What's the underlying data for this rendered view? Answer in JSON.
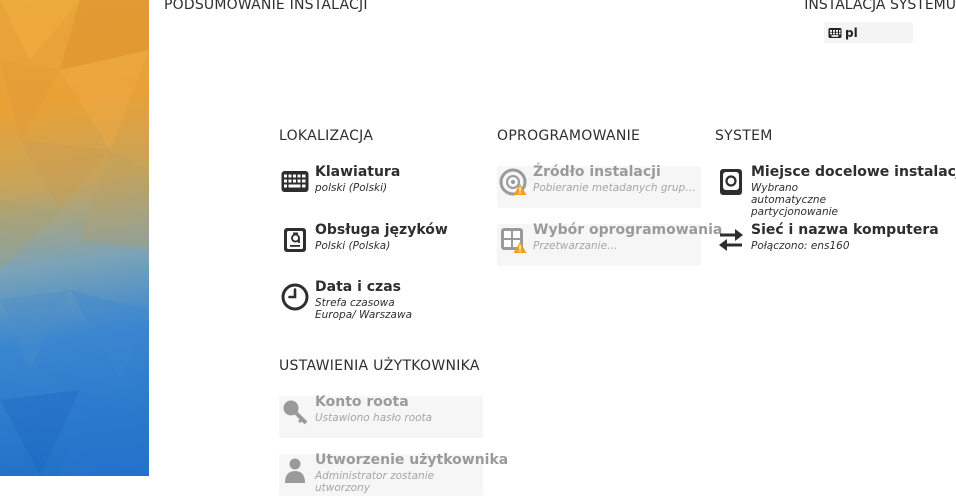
{
  "header": {
    "page_title": "PODSUMOWANIE INSTALACJI",
    "install_title": "INSTALACJA SYSTEMU",
    "keyboard_layout": "pl"
  },
  "sections": {
    "localization": {
      "title": "LOKALIZACJA",
      "keyboard": {
        "title": "Klawiatura",
        "status": "polski (Polski)"
      },
      "language": {
        "title": "Obsługa języków",
        "status": "Polski (Polska)"
      },
      "datetime": {
        "title": "Data i czas",
        "status": "Strefa czasowa Europa/ Warszawa"
      }
    },
    "software": {
      "title": "OPROGRAMOWANIE",
      "source": {
        "title": "Źródło instalacji",
        "status": "Pobieranie metadanych grup…"
      },
      "selection": {
        "title": "Wybór oprogramowania",
        "status": "Przetwarzanie…"
      }
    },
    "system": {
      "title": "SYSTEM",
      "destination": {
        "title": "Miejsce docelowe instalacji",
        "status": "Wybrano automatyczne partycjonowanie"
      },
      "network": {
        "title": "Sieć i nazwa komputera",
        "status": "Połączono: ens160"
      }
    },
    "user": {
      "title": "USTAWIENIA UŻYTKOWNIKA",
      "root": {
        "title": "Konto roota",
        "status": "Ustawiono hasło roota"
      },
      "user_creation": {
        "title": "Utworzenie użytkownika",
        "status": "Administrator zostanie utworzony"
      }
    }
  },
  "icons": {
    "keyboard": "keyboard-icon",
    "language": "language-icon",
    "clock": "clock-icon",
    "disc": "disc-icon",
    "package": "package-icon",
    "warning": "warning-icon",
    "harddisk": "harddisk-icon",
    "network": "network-arrows-icon",
    "key": "key-icon",
    "user": "user-icon"
  },
  "colors": {
    "text": "#2e2e2e",
    "disabled_text": "#9a9a9a",
    "warning": "#f0a020",
    "sidebar_top": "#e9a136",
    "sidebar_bottom": "#1e6fc8"
  }
}
